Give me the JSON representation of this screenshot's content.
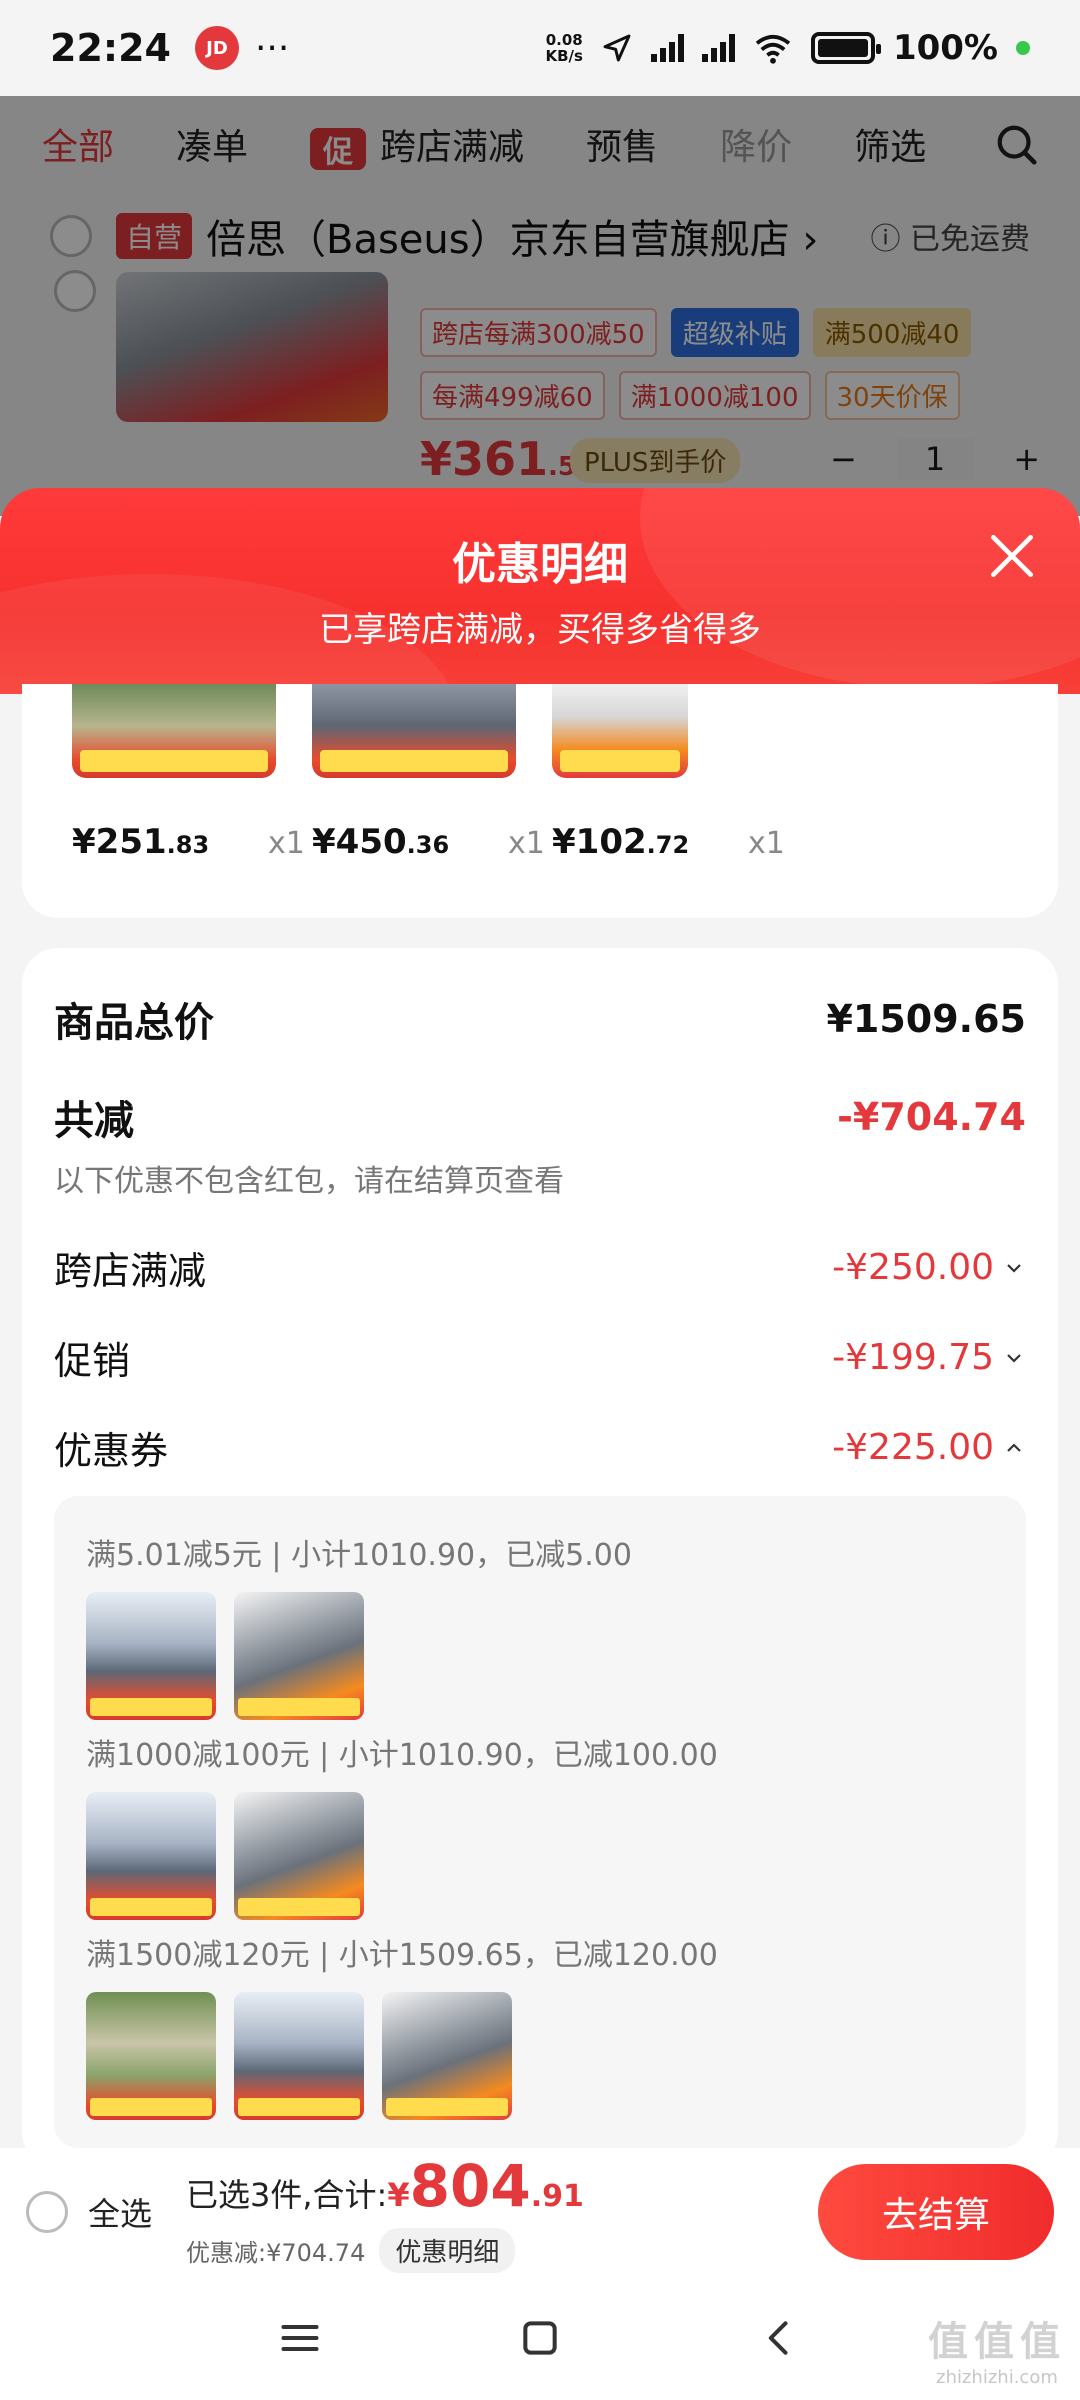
{
  "status_bar": {
    "time": "22:24",
    "app_icon_text": "JD",
    "dots": "···",
    "net_speed_value": "0.08",
    "net_speed_unit": "KB/s",
    "battery_pct": "100%",
    "battery_level": 1.0
  },
  "tabs": {
    "all": "全部",
    "collect": "凑单",
    "promo_chip": "促",
    "cross_store": "跨店满减",
    "presale": "预售",
    "price_drop": "降价",
    "filter": "筛选"
  },
  "store": {
    "self_tag": "自营",
    "name": "倍思（Baseus）京东自营旗舰店",
    "arrow": "›",
    "shipping": "ⓘ 已免运费"
  },
  "cart_item": {
    "tags": [
      "跨店每满300减50",
      "超级补贴",
      "满500减40",
      "每满499减60",
      "满1000减100",
      "30天价保"
    ],
    "price_main": "¥361",
    "price_dec": ".51",
    "plus_tag": "PLUS到手价",
    "minus": "−",
    "qty": "1",
    "plus": "+"
  },
  "sheet": {
    "title": "优惠明细",
    "subtitle": "已享跨店满减，买得多省得多"
  },
  "products": [
    {
      "price_int": "¥251",
      "price_dec": ".83",
      "qty": "x1"
    },
    {
      "price_int": "¥450",
      "price_dec": ".36",
      "qty": "x1"
    },
    {
      "price_int": "¥102",
      "price_dec": ".72",
      "qty": "x1"
    }
  ],
  "summary": {
    "total_label": "商品总价",
    "total_value": "¥1509.65",
    "reduced_label": "共减",
    "reduced_value": "-¥704.74",
    "note": "以下优惠不包含红包，请在结算页查看",
    "lines": [
      {
        "label": "跨店满减",
        "value": "-¥250.00",
        "expanded": false
      },
      {
        "label": "促销",
        "value": "-¥199.75",
        "expanded": false
      },
      {
        "label": "优惠券",
        "value": "-¥225.00",
        "expanded": true
      }
    ]
  },
  "coupons": [
    {
      "text": "满5.01减5元 | 小计1010.90，已减5.00",
      "thumbs": [
        "hub",
        "green"
      ]
    },
    {
      "text": "满1000减100元 | 小计1010.90，已减100.00",
      "thumbs": [
        "hub",
        "green"
      ]
    },
    {
      "text": "满1500减120元 | 小计1509.65，已减120.00",
      "thumbs": [
        "tent",
        "hub",
        "green"
      ]
    }
  ],
  "bottom_bar": {
    "select_all": "全选",
    "selected_text": "已选3件,合计:",
    "currency": "¥",
    "total_int": "804",
    "total_dec": ".91",
    "discount_text": "优惠减:¥704.74",
    "detail_pill": "优惠明细",
    "checkout": "去结算"
  },
  "watermark": {
    "logo": "值值值",
    "url": "zhizhizhi.com"
  },
  "colors": {
    "accent": "#e4393c",
    "sheet_header": "#f6312e",
    "page_bg": "#f4f4f4"
  }
}
